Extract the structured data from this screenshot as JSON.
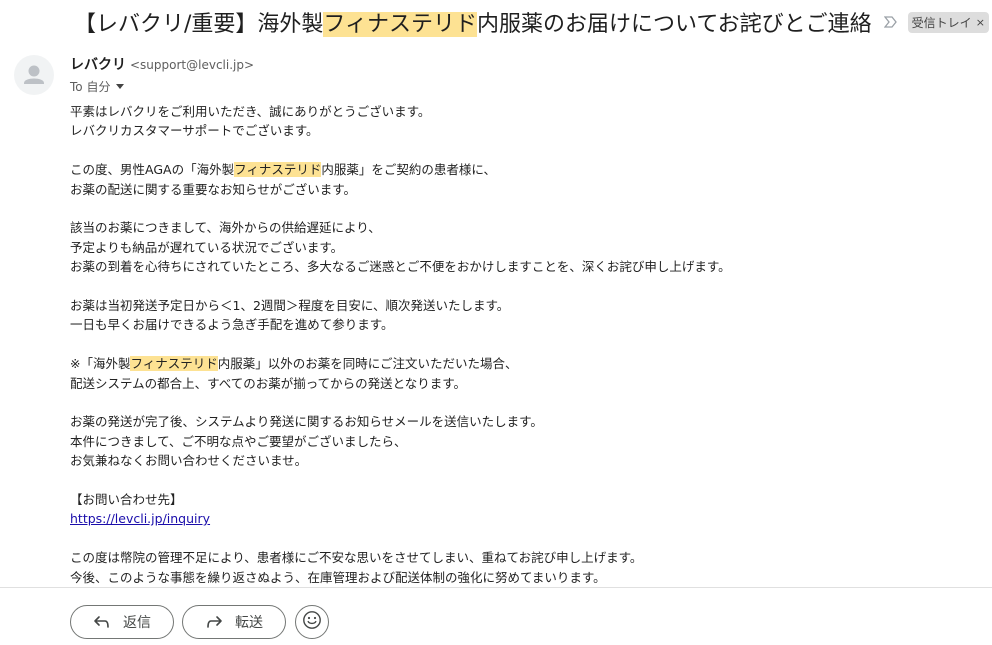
{
  "subject": {
    "prefix": "【レバクリ/重要】海外製",
    "highlight": "フィナステリド",
    "suffix": "内服薬のお届けについてお詫びとご連絡",
    "label": "受信トレイ",
    "label_close": "×"
  },
  "sender": {
    "name": "レバクリ",
    "email": "<support@levcli.jp>",
    "to": "To 自分"
  },
  "body": {
    "p1": [
      "平素はレバクリをご利用いただき、誠にありがとうございます。",
      "レバクリカスタマーサポートでございます。"
    ],
    "p2_l1_pre": "この度、男性AGAの「海外製",
    "p2_l1_hl": "フィナステリド",
    "p2_l1_post": "内服薬」をご契約の患者様に、",
    "p2_l2": "お薬の配送に関する重要なお知らせがございます。",
    "p3": [
      "該当のお薬につきまして、海外からの供給遅延により、",
      "予定よりも納品が遅れている状況でございます。",
      "お薬の到着を心待ちにされていたところ、多大なるご迷惑とご不便をおかけしますことを、深くお詫び申し上げます。"
    ],
    "p4": [
      "お薬は当初発送予定日から＜1、2週間＞程度を目安に、順次発送いたします。",
      "一日も早くお届けできるよう急ぎ手配を進めて参ります。"
    ],
    "p5_l1_pre": "※「海外製",
    "p5_l1_hl": "フィナステリド",
    "p5_l1_post": "内服薬」以外のお薬を同時にご注文いただいた場合、",
    "p5_l2": "配送システムの都合上、すべてのお薬が揃ってからの発送となります。",
    "p6": [
      "お薬の発送が完了後、システムより発送に関するお知らせメールを送信いたします。",
      "本件につきまして、ご不明な点やご要望がございましたら、",
      "お気兼ねなくお問い合わせくださいませ。"
    ],
    "contact_heading": "【お問い合わせ先】",
    "contact_link": "https://levcli.jp/inquiry",
    "p8": [
      "この度は幣院の管理不足により、患者様にご不安な思いをさせてしまい、重ねてお詫び申し上げます。",
      "今後、このような事態を繰り返さぬよう、在庫管理および配送体制の強化に努めてまいります。"
    ]
  },
  "actions": {
    "reply_label": "返信",
    "forward_label": "転送"
  },
  "icons": {
    "importance": "importance-marker-icon",
    "avatar": "default-avatar-icon",
    "reply": "reply-arrow-icon",
    "forward": "forward-arrow-icon",
    "emoji": "emoji-smile-icon"
  },
  "colors": {
    "highlight": "#fde293",
    "link": "#1a0dab"
  }
}
